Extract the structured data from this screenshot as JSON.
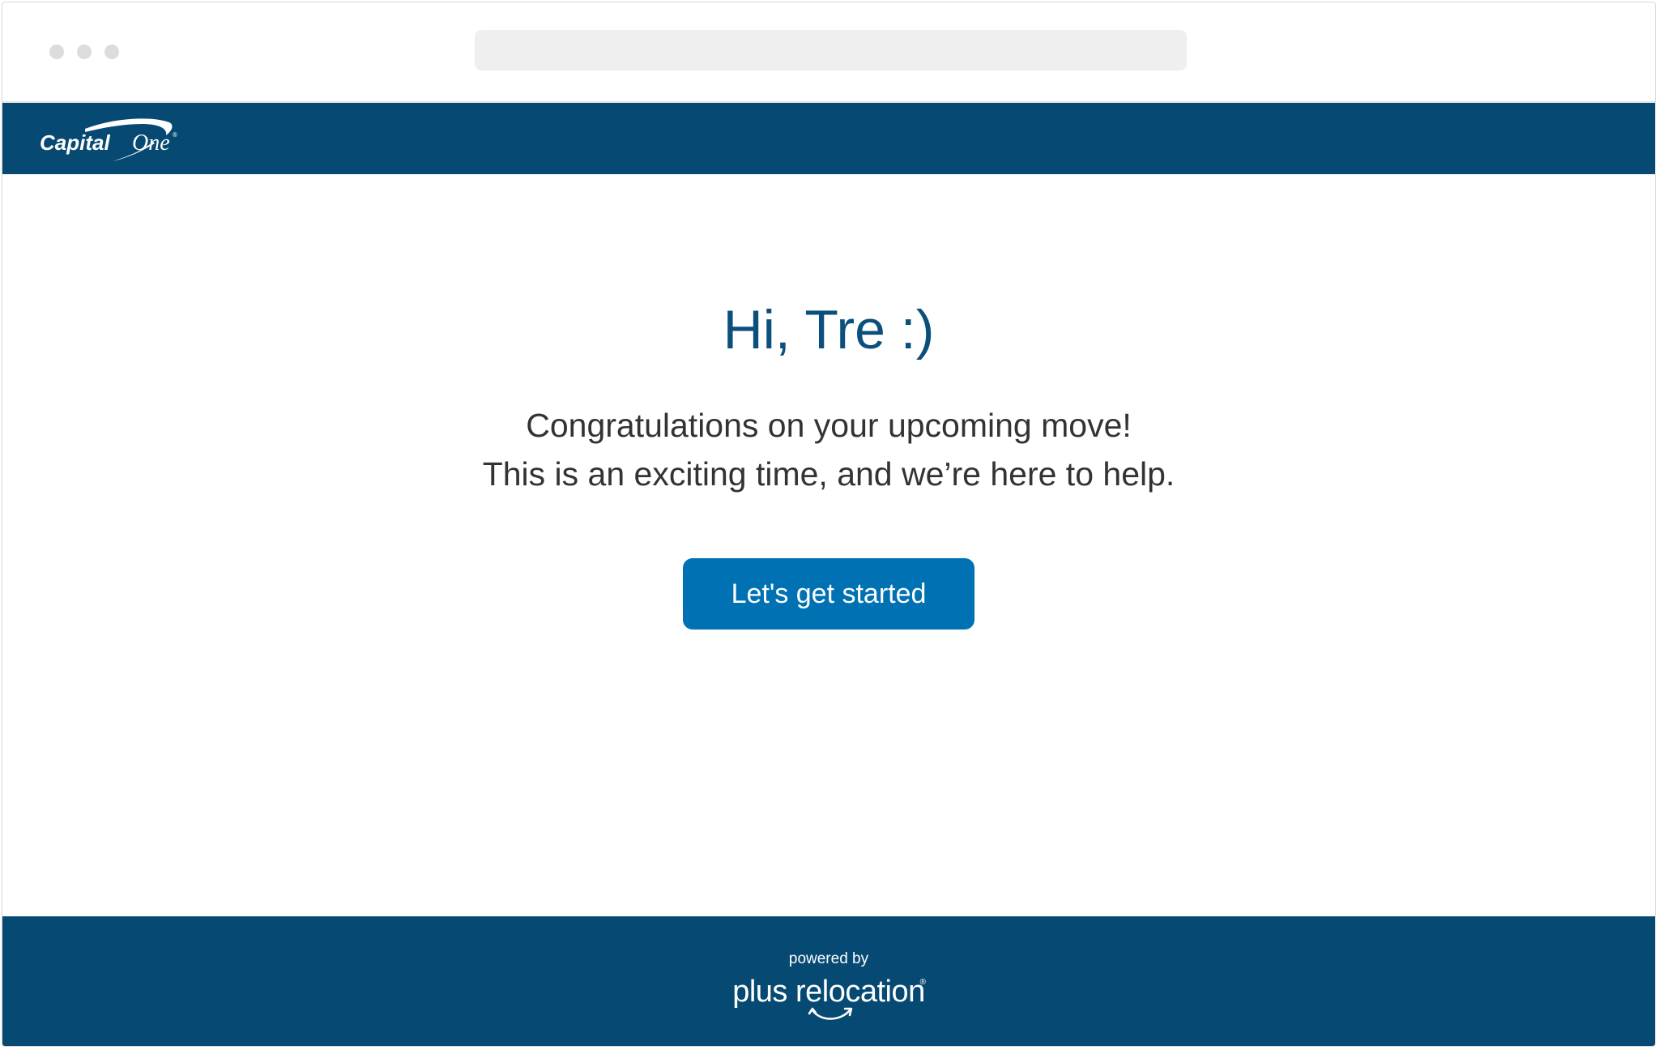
{
  "browser": {
    "url": ""
  },
  "header": {
    "brand_name": "Capital One",
    "logo_text_left": "Capital",
    "logo_text_right": "One",
    "logo_reg": "®",
    "brand_color": "#064a73"
  },
  "main": {
    "greeting": "Hi, Tre :)",
    "message_line1": "Congratulations on your upcoming move!",
    "message_line2": "This is an exciting time, and we’re here to help.",
    "cta_label": "Let's get started",
    "greeting_color": "#0b4f7c",
    "cta_color": "#0071b3"
  },
  "footer": {
    "powered_by": "powered by",
    "partner_name": "plus relocation",
    "partner_reg": "®"
  }
}
